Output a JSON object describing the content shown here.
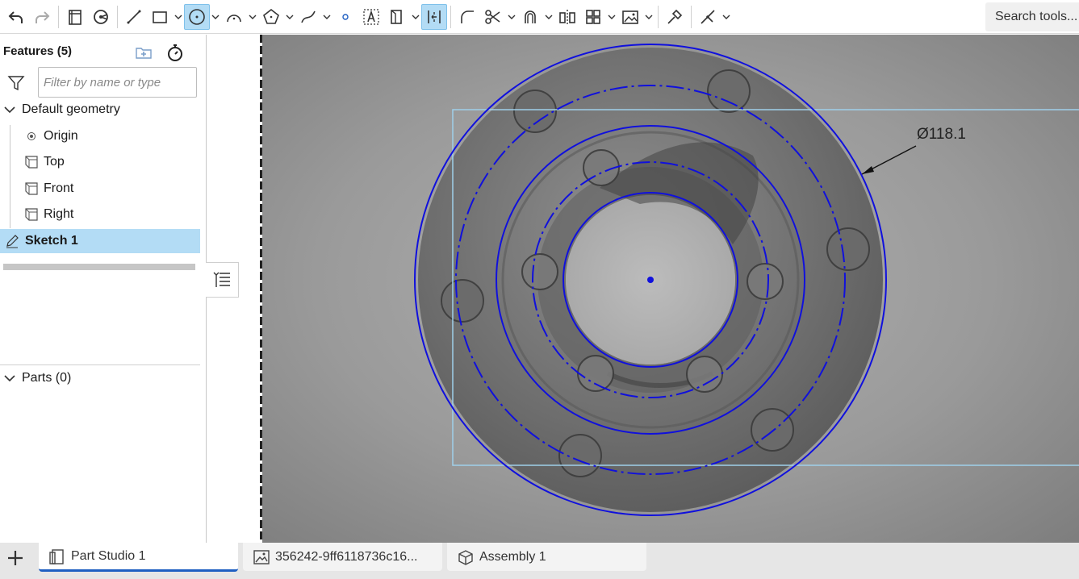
{
  "toolbar": {
    "search_label": "Search tools..."
  },
  "features": {
    "title": "Features (5)",
    "filter_placeholder": "Filter by name or type",
    "default_geometry": "Default geometry",
    "items": [
      "Origin",
      "Top",
      "Front",
      "Right"
    ],
    "sketch": "Sketch 1",
    "parts": "Parts (0)"
  },
  "viewport": {
    "dimension_label": "Ø118.1"
  },
  "tabs": [
    {
      "label": "Part Studio 1"
    },
    {
      "label": "356242-9ff6118736c16..."
    },
    {
      "label": "Assembly 1"
    }
  ],
  "colors": {
    "accent": "#1f5fc2",
    "selection": "#b3dcf5",
    "sketch_blue": "#1010dd",
    "bounding_box": "#9fd0ea"
  }
}
